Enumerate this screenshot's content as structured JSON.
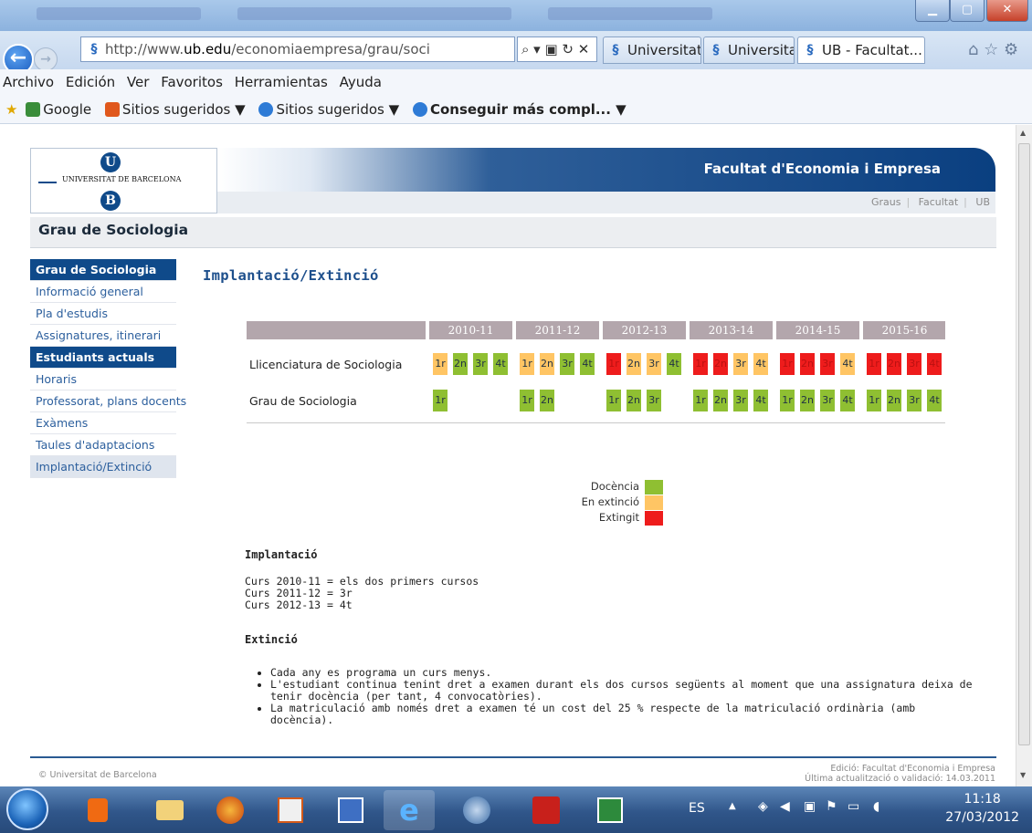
{
  "browser": {
    "url_prefix": "http://www.",
    "url_domain": "ub.edu",
    "url_suffix": "/economiaempresa/grau/soci",
    "url_tools": "⌕ ▾ ▣ ↻ ✕",
    "tabs": [
      {
        "label": "Universitat de ...",
        "active": false
      },
      {
        "label": "Universitat de ...",
        "active": false
      },
      {
        "label": "UB - Facultat...",
        "active": true,
        "close": "×"
      }
    ],
    "window_buttons": {
      "minimize": "▁",
      "maximize": "▢",
      "close": "✕"
    },
    "right_icons": "⌂ ☆ ⚙"
  },
  "menubar": [
    "Archivo",
    "Edición",
    "Ver",
    "Favoritos",
    "Herramientas",
    "Ayuda"
  ],
  "favorites": [
    {
      "label": "Google",
      "color": "#3a8d3a",
      "dropdown": false
    },
    {
      "label": "Sitios sugeridos ▼",
      "color": "#e0581c",
      "dropdown": true
    },
    {
      "label": "Sitios sugeridos ▼",
      "color": "#2e7bd6",
      "dropdown": true
    },
    {
      "label": "Conseguir más compl... ▼",
      "color": "#2e7bd6",
      "dropdown": true,
      "bold": true
    }
  ],
  "site": {
    "logo_letter_top": "U",
    "logo_text": "UNIVERSITAT DE BARCELONA",
    "logo_letter_bottom": "B",
    "faculty": "Facultat d'Economia i Empresa",
    "top_links": [
      "Graus",
      "Facultat",
      "UB"
    ],
    "section_title": "Grau de Sociologia"
  },
  "sidebar": [
    {
      "label": "Grau de Sociologia",
      "type": "head"
    },
    {
      "label": "Informació general",
      "type": "link"
    },
    {
      "label": "Pla d'estudis",
      "type": "link"
    },
    {
      "label": "Assignatures, itinerari",
      "type": "link"
    },
    {
      "label": "Estudiants actuals",
      "type": "head"
    },
    {
      "label": "Horaris",
      "type": "link"
    },
    {
      "label": "Professorat, plans docents",
      "type": "link"
    },
    {
      "label": "Exàmens",
      "type": "link"
    },
    {
      "label": "Taules d'adaptacions",
      "type": "link"
    },
    {
      "label": "Implantació/Extinció",
      "type": "selected"
    }
  ],
  "content": {
    "title": "Implantació/Extinció",
    "years": [
      "2010-11",
      "2011-12",
      "2012-13",
      "2013-14",
      "2014-15",
      "2015-16"
    ],
    "rows": [
      {
        "label": "Llicenciatura de Sociologia",
        "years": [
          [
            [
              "1r",
              "x"
            ],
            [
              "2n",
              "d"
            ],
            [
              "3r",
              "d"
            ],
            [
              "4t",
              "d"
            ]
          ],
          [
            [
              "1r",
              "x"
            ],
            [
              "2n",
              "x"
            ],
            [
              "3r",
              "d"
            ],
            [
              "4t",
              "d"
            ]
          ],
          [
            [
              "1r",
              "e"
            ],
            [
              "2n",
              "x"
            ],
            [
              "3r",
              "x"
            ],
            [
              "4t",
              "d"
            ]
          ],
          [
            [
              "1r",
              "e"
            ],
            [
              "2n",
              "e"
            ],
            [
              "3r",
              "x"
            ],
            [
              "4t",
              "x"
            ]
          ],
          [
            [
              "1r",
              "e"
            ],
            [
              "2n",
              "e"
            ],
            [
              "3r",
              "e"
            ],
            [
              "4t",
              "x"
            ]
          ],
          [
            [
              "1r",
              "e"
            ],
            [
              "2n",
              "e"
            ],
            [
              "3r",
              "e"
            ],
            [
              "4t",
              "e"
            ]
          ]
        ]
      },
      {
        "label": "Grau de Sociologia",
        "years": [
          [
            [
              "1r",
              "d"
            ]
          ],
          [
            [
              "1r",
              "d"
            ],
            [
              "2n",
              "d"
            ]
          ],
          [
            [
              "1r",
              "d"
            ],
            [
              "2n",
              "d"
            ],
            [
              "3r",
              "d"
            ]
          ],
          [
            [
              "1r",
              "d"
            ],
            [
              "2n",
              "d"
            ],
            [
              "3r",
              "d"
            ],
            [
              "4t",
              "d"
            ]
          ],
          [
            [
              "1r",
              "d"
            ],
            [
              "2n",
              "d"
            ],
            [
              "3r",
              "d"
            ],
            [
              "4t",
              "d"
            ]
          ],
          [
            [
              "1r",
              "d"
            ],
            [
              "2n",
              "d"
            ],
            [
              "3r",
              "d"
            ],
            [
              "4t",
              "d"
            ]
          ]
        ]
      }
    ],
    "legend": [
      {
        "label": "Docència",
        "color": "#8fbf32"
      },
      {
        "label": "En extinció",
        "color": "#ffc564"
      },
      {
        "label": "Extingit",
        "color": "#ee1c1c"
      }
    ],
    "implantacio_heading": "Implantació",
    "implantacio_lines": [
      "Curs 2010-11 = els dos primers cursos",
      "Curs 2011-12 = 3r",
      "Curs 2012-13 = 4t"
    ],
    "extincio_heading": "Extinció",
    "extincio_items": [
      "Cada any es programa un curs menys.",
      "L'estudiant continua tenint dret a examen durant els dos cursos següents al moment que una assignatura deixa de tenir docència (per tant, 4 convocatòries).",
      "La matriculació amb només dret a examen té un cost del 25 % respecte de la matriculació ordinària (amb docència)."
    ]
  },
  "footer": {
    "left": "© Universitat de Barcelona",
    "right_line1": "Edició: Facultat d'Economia i Empresa",
    "right_line2": "Última actualització o validació: 14.03.2011"
  },
  "taskbar": {
    "language": "ES",
    "time": "11:18",
    "date": "27/03/2012"
  },
  "colors": {
    "docencia": "#8fbf32",
    "en_extincio": "#ffc564",
    "extingit": "#ee1c1c",
    "ub_blue": "#0f4a8a"
  }
}
